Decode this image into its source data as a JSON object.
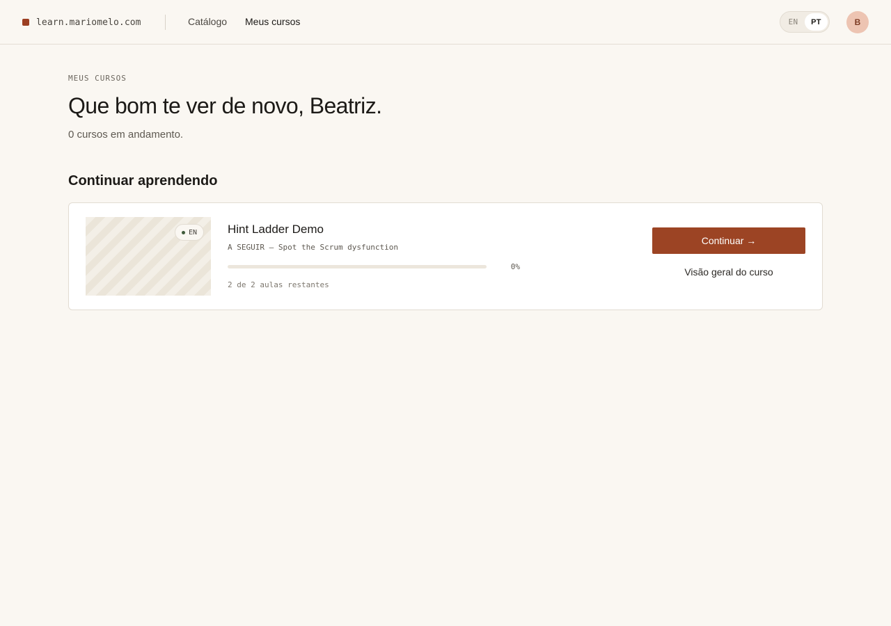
{
  "header": {
    "brand": "learn.mariomelo.com",
    "nav": {
      "catalog": "Catálogo",
      "my_courses": "Meus cursos"
    },
    "languages": {
      "en": "EN",
      "pt": "PT",
      "selected": "PT"
    },
    "avatar_initial": "B"
  },
  "main": {
    "eyebrow": "MEUS CURSOS",
    "title": "Que bom te ver de novo, Beatriz.",
    "subtitle": "0 cursos em andamento.",
    "section_title": "Continuar aprendendo"
  },
  "course": {
    "language_badge": "EN",
    "title": "Hint Ladder Demo",
    "next_lesson": "A SEGUIR — Spot the Scrum dysfunction",
    "progress_percent": 0,
    "progress_label": "0%",
    "lessons_remaining": "2 de 2 aulas restantes",
    "continue_label": "Continuar →",
    "overview_label": "Visão geral do curso"
  },
  "colors": {
    "accent": "#9c4424",
    "background": "#faf7f2",
    "avatar_bg": "#edc4b2"
  },
  "icons": {
    "brand": "square-dot-icon",
    "badge_dot": "status-dot-icon"
  }
}
